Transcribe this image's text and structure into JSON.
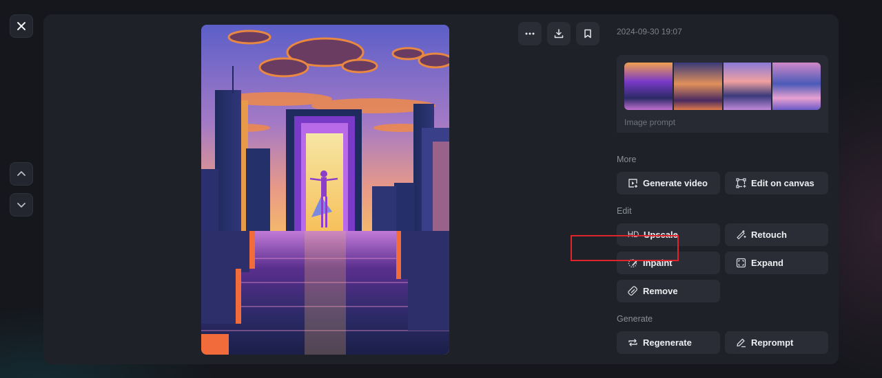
{
  "nav": {
    "close_icon": "close-icon",
    "prev_icon": "chevron-up-icon",
    "next_icon": "chevron-down-icon"
  },
  "image": {
    "description": "Futuristic neon city at sunset with a glowing purple portal and a chrome figure dancing on a reflective walkway"
  },
  "top_actions": [
    {
      "name": "more",
      "icon": "more-horizontal-icon"
    },
    {
      "name": "download",
      "icon": "download-icon"
    },
    {
      "name": "bookmark",
      "icon": "bookmark-icon"
    }
  ],
  "side": {
    "timestamp": "2024-09-30 19:07",
    "prompt_label": "Image prompt",
    "thumbnail_count": 4,
    "sections": {
      "more": "More",
      "edit": "Edit",
      "generate": "Generate"
    },
    "buttons": {
      "generate_video": "Generate video",
      "edit_on_canvas": "Edit on canvas",
      "upscale": "Upscale",
      "upscale_badge": "HD",
      "retouch": "Retouch",
      "inpaint": "Inpaint",
      "expand": "Expand",
      "remove": "Remove",
      "regenerate": "Regenerate",
      "reprompt": "Reprompt"
    },
    "highlighted_button": "inpaint"
  },
  "colors": {
    "background": "#15171c",
    "panel": "#1f2128",
    "button": "#2a2d36",
    "highlight": "#e0242c",
    "muted_text": "#7c808a"
  }
}
